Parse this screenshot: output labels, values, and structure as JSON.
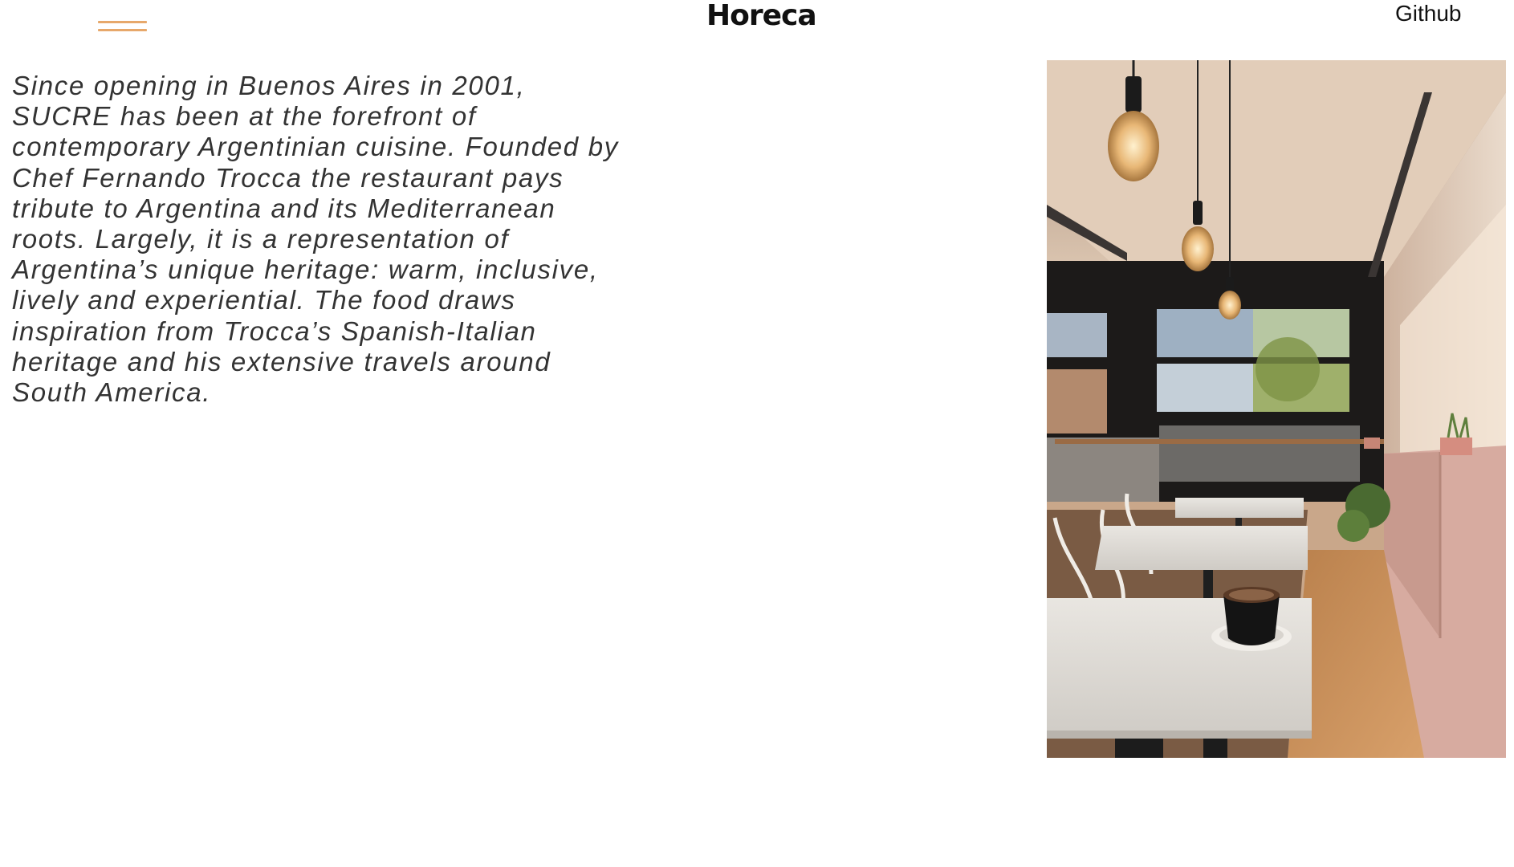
{
  "header": {
    "menu_icon": "hamburger-menu-icon",
    "logo": "Horeca",
    "nav_link": "Github"
  },
  "main": {
    "intro": "Since opening in Buenos Aires in 2001, SUCRE has been at the forefront of contemporary Argentinian cuisine. Founded by Chef Fernando Trocca the restaurant pays tribute to Argentina and its Mediterranean roots. Largely, it is a representation of Argentina’s unique heritage: warm, inclusive, lively and experiential. The food draws inspiration from Trocca’s Spanish-Italian heritage and his extensive travels around South America."
  },
  "photo": {
    "subject": "restaurant-interior-image"
  },
  "colors": {
    "accent": "#e7a86b",
    "text": "#333333",
    "logo": "#111111"
  }
}
